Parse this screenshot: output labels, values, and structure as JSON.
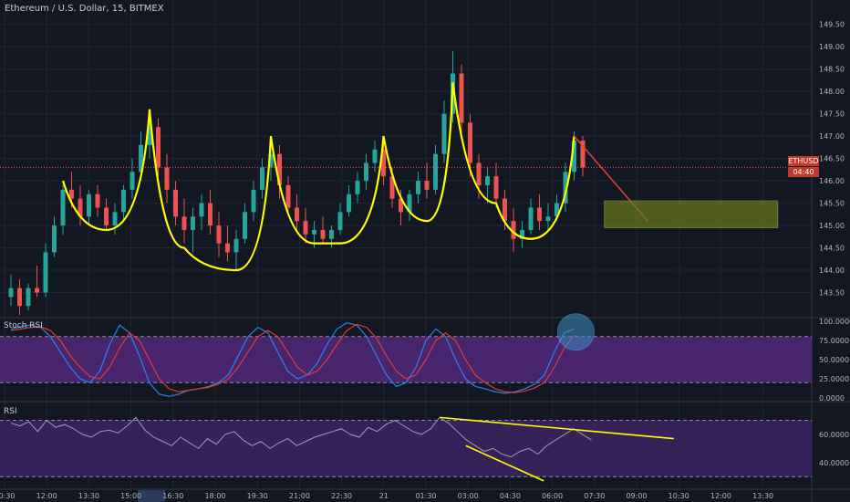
{
  "header": {
    "title": "Ethereum / U.S. Dollar, 15, BITMEX"
  },
  "price_tags": {
    "symbol_price": "ETHUSD 146.30",
    "countdown": "04:40"
  },
  "colors": {
    "background": "#131722",
    "grid": "#1f2433",
    "bull": "#26a69a",
    "bear": "#ef5350",
    "pattern": "#ffff00",
    "target_box": "#6b7a1e",
    "stoch_band": "#5b2a86",
    "stoch_k": "#2f80ed",
    "stoch_d": "#e53935",
    "rsi_band": "#3d2463",
    "rsi_line": "#9aa0ad",
    "projection": "#e0403a",
    "highlight": "#3b8fc2"
  },
  "chart_data": [
    {
      "type": "candlestick",
      "title": "Ethereum / U.S. Dollar, 15, BITMEX",
      "ylim": [
        143.0,
        149.8
      ],
      "y_ticks": [
        "149.50",
        "149.00",
        "148.50",
        "148.00",
        "147.50",
        "147.00",
        "146.50",
        "146.00",
        "145.50",
        "145.00",
        "144.50",
        "144.00",
        "143.50"
      ],
      "x_ticks": [
        "10:30",
        "12:00",
        "13:30",
        "15:00",
        "16:30",
        "18:00",
        "19:30",
        "21:00",
        "22:30",
        "21",
        "01:30",
        "03:00",
        "04:30",
        "06:00",
        "07:30",
        "09:00",
        "10:30",
        "12:00",
        "13:30"
      ],
      "last_price": 146.3,
      "candles": [
        [
          143.4,
          143.9,
          143.2,
          143.6
        ],
        [
          143.6,
          143.8,
          143.0,
          143.2
        ],
        [
          143.2,
          143.7,
          143.1,
          143.6
        ],
        [
          143.6,
          144.1,
          143.4,
          143.5
        ],
        [
          143.5,
          144.6,
          143.4,
          144.4
        ],
        [
          144.4,
          145.2,
          144.3,
          145.0
        ],
        [
          145.0,
          145.9,
          144.8,
          145.8
        ],
        [
          145.8,
          146.2,
          145.4,
          145.6
        ],
        [
          145.6,
          145.9,
          145.0,
          145.2
        ],
        [
          145.2,
          145.8,
          145.0,
          145.7
        ],
        [
          145.7,
          145.9,
          145.2,
          145.4
        ],
        [
          145.4,
          145.6,
          144.9,
          145.0
        ],
        [
          145.0,
          145.5,
          144.8,
          145.3
        ],
        [
          145.3,
          145.9,
          145.1,
          145.8
        ],
        [
          145.8,
          146.5,
          145.6,
          146.2
        ],
        [
          146.2,
          147.1,
          146.0,
          146.8
        ],
        [
          146.8,
          147.6,
          146.5,
          147.2
        ],
        [
          147.2,
          147.4,
          146.1,
          146.3
        ],
        [
          146.3,
          146.6,
          145.5,
          145.8
        ],
        [
          145.8,
          146.0,
          145.0,
          145.2
        ],
        [
          145.2,
          145.6,
          144.6,
          144.9
        ],
        [
          144.9,
          145.4,
          144.4,
          145.2
        ],
        [
          145.2,
          145.7,
          144.9,
          145.5
        ],
        [
          145.5,
          145.8,
          144.8,
          145.0
        ],
        [
          145.0,
          145.3,
          144.3,
          144.6
        ],
        [
          144.6,
          145.0,
          144.2,
          144.4
        ],
        [
          144.4,
          144.9,
          144.0,
          144.7
        ],
        [
          144.7,
          145.5,
          144.6,
          145.3
        ],
        [
          145.3,
          146.0,
          145.1,
          145.8
        ],
        [
          145.8,
          146.5,
          145.6,
          146.3
        ],
        [
          146.3,
          146.9,
          146.0,
          146.6
        ],
        [
          146.6,
          146.8,
          145.6,
          145.9
        ],
        [
          145.9,
          146.1,
          145.2,
          145.4
        ],
        [
          145.4,
          145.7,
          144.9,
          145.1
        ],
        [
          145.1,
          145.4,
          144.6,
          144.8
        ],
        [
          144.8,
          145.1,
          144.5,
          144.9
        ],
        [
          144.9,
          145.2,
          144.6,
          144.7
        ],
        [
          144.7,
          145.0,
          144.5,
          144.9
        ],
        [
          144.9,
          145.5,
          144.8,
          145.3
        ],
        [
          145.3,
          145.9,
          145.2,
          145.7
        ],
        [
          145.7,
          146.2,
          145.5,
          146.0
        ],
        [
          146.0,
          146.6,
          145.8,
          146.4
        ],
        [
          146.4,
          146.9,
          146.2,
          146.7
        ],
        [
          146.7,
          146.9,
          145.9,
          146.1
        ],
        [
          146.1,
          146.3,
          145.4,
          145.6
        ],
        [
          145.6,
          145.8,
          145.0,
          145.3
        ],
        [
          145.3,
          145.8,
          145.1,
          145.7
        ],
        [
          145.7,
          146.2,
          145.5,
          146.0
        ],
        [
          146.0,
          146.4,
          145.6,
          145.8
        ],
        [
          145.8,
          146.8,
          145.7,
          146.6
        ],
        [
          146.6,
          147.8,
          146.4,
          147.5
        ],
        [
          147.5,
          148.9,
          147.3,
          148.4
        ],
        [
          148.4,
          148.6,
          147.0,
          147.3
        ],
        [
          147.3,
          147.5,
          146.1,
          146.4
        ],
        [
          146.4,
          146.6,
          145.6,
          145.9
        ],
        [
          145.9,
          146.3,
          145.5,
          146.1
        ],
        [
          146.1,
          146.4,
          145.4,
          145.6
        ],
        [
          145.6,
          145.8,
          144.9,
          145.1
        ],
        [
          145.1,
          145.4,
          144.4,
          144.7
        ],
        [
          144.7,
          145.1,
          144.5,
          144.9
        ],
        [
          144.9,
          145.6,
          144.8,
          145.4
        ],
        [
          145.4,
          145.7,
          144.9,
          145.1
        ],
        [
          145.1,
          145.5,
          144.9,
          145.2
        ],
        [
          145.2,
          145.7,
          145.1,
          145.5
        ],
        [
          145.5,
          146.4,
          145.3,
          146.2
        ],
        [
          146.2,
          147.1,
          146.0,
          146.9
        ],
        [
          146.9,
          147.0,
          146.1,
          146.3
        ]
      ]
    },
    {
      "type": "line",
      "title": "Stoch RSI",
      "ylim": [
        0,
        100
      ],
      "y_ticks": [
        "100.0000",
        "75.0000",
        "50.0000",
        "25.0000",
        "0.0000"
      ],
      "band": [
        20,
        80
      ],
      "series": [
        {
          "values": [
            90,
            93,
            95,
            92,
            80,
            60,
            40,
            25,
            20,
            35,
            70,
            95,
            85,
            55,
            20,
            5,
            2,
            5,
            10,
            12,
            15,
            20,
            30,
            55,
            80,
            92,
            85,
            60,
            35,
            25,
            30,
            45,
            70,
            90,
            98,
            95,
            80,
            55,
            30,
            15,
            20,
            40,
            75,
            90,
            80,
            50,
            25,
            15,
            12,
            8,
            6,
            8,
            12,
            18,
            30,
            60,
            85,
            90
          ]
        },
        {
          "values": [
            88,
            90,
            92,
            93,
            88,
            75,
            55,
            40,
            28,
            25,
            40,
            65,
            85,
            75,
            50,
            25,
            12,
            8,
            10,
            12,
            14,
            18,
            25,
            40,
            60,
            80,
            88,
            80,
            60,
            40,
            30,
            35,
            50,
            70,
            88,
            96,
            92,
            78,
            55,
            35,
            25,
            30,
            50,
            75,
            85,
            75,
            50,
            30,
            20,
            12,
            8,
            7,
            9,
            13,
            20,
            40,
            65,
            82
          ]
        }
      ]
    },
    {
      "type": "line",
      "title": "RSI",
      "ylim": [
        25,
        80
      ],
      "y_ticks": [
        "60.0000",
        "40.0000"
      ],
      "band": [
        30,
        70
      ],
      "series": [
        {
          "values": [
            68,
            66,
            69,
            62,
            70,
            65,
            67,
            64,
            60,
            58,
            62,
            63,
            61,
            66,
            72,
            63,
            58,
            55,
            52,
            58,
            54,
            50,
            57,
            53,
            60,
            62,
            56,
            52,
            55,
            50,
            54,
            57,
            52,
            55,
            58,
            60,
            62,
            64,
            60,
            58,
            65,
            62,
            67,
            70,
            66,
            62,
            60,
            64,
            72,
            68,
            62,
            56,
            52,
            48,
            50,
            46,
            44,
            48,
            50,
            46,
            52,
            56,
            60,
            64,
            60,
            56
          ]
        }
      ]
    }
  ]
}
